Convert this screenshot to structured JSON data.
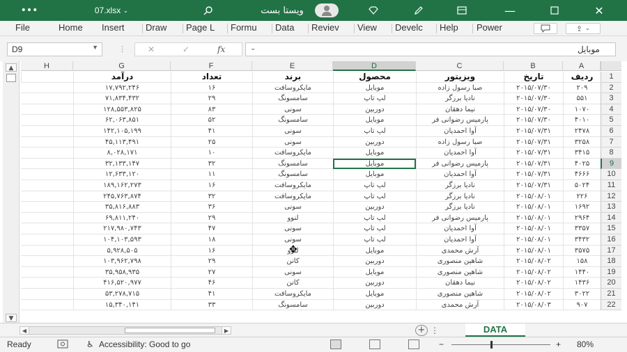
{
  "titlebar": {
    "filename": "07.xlsx",
    "username": "ویستا بست",
    "icons": [
      "more-icon",
      "search-icon",
      "diamond-icon",
      "pen-icon",
      "ribbon-display-icon",
      "minimize-icon",
      "restore-icon",
      "close-icon"
    ]
  },
  "ribbon": {
    "tabs": [
      "File",
      "Home",
      "Insert",
      "Draw",
      "Page L",
      "Formu",
      "Data",
      "Reviev",
      "View",
      "Develc",
      "Help",
      "Power"
    ]
  },
  "formula_bar": {
    "cell_ref": "D9",
    "cancel_symbol": "✕",
    "enter_symbol": "✓",
    "fx_symbol": "fx",
    "content": "موبایل"
  },
  "columns": [
    "H",
    "G",
    "F",
    "E",
    "D",
    "C",
    "B",
    "A"
  ],
  "selected_column": "D",
  "selected_row": "9",
  "table": {
    "header": {
      "A": "ردیف",
      "B": "تاریخ",
      "C": "ویزیتور",
      "D": "محصول",
      "E": "برند",
      "F": "تعداد",
      "G": "درآمد",
      "H": ""
    },
    "rows": [
      {
        "n": "2",
        "A": "۲۰۹",
        "B": "۲۰۱۵/۰۷/۳۰",
        "C": "صبا رسول زاده",
        "D": "موبایل",
        "E": "مایکروسافت",
        "F": "۱۶",
        "G": "۱۷,۷۹۲,۲۴۶"
      },
      {
        "n": "3",
        "A": "۵۵۱",
        "B": "۲۰۱۵/۰۷/۳۰",
        "C": "نادیا برزگر",
        "D": "لپ تاپ",
        "E": "سامسونگ",
        "F": "۲۹",
        "G": "۷۱,۸۳۴,۴۳۲"
      },
      {
        "n": "4",
        "A": "۱۰۷۰",
        "B": "۲۰۱۵/۰۷/۳۰",
        "C": "نیما دهقان",
        "D": "دوربین",
        "E": "سونی",
        "F": "۸۳",
        "G": "۱۲۸,۵۵۳,۸۲۵"
      },
      {
        "n": "5",
        "A": "۴۰۱۰",
        "B": "۲۰۱۵/۰۷/۳۰",
        "C": "پارمیس رضوانی فر",
        "D": "موبایل",
        "E": "سامسونگ",
        "F": "۵۲",
        "G": "۶۲,۰۶۳,۸۵۱"
      },
      {
        "n": "6",
        "A": "۲۴۷۸",
        "B": "۲۰۱۵/۰۷/۳۱",
        "C": "آوا احمدیان",
        "D": "لپ تاپ",
        "E": "سونی",
        "F": "۴۱",
        "G": "۱۴۲,۱۰۵,۱۹۹"
      },
      {
        "n": "7",
        "A": "۳۲۵۸",
        "B": "۲۰۱۵/۰۷/۳۱",
        "C": "صبا رسول زاده",
        "D": "دوربین",
        "E": "سونی",
        "F": "۲۵",
        "G": "۴۵,۱۱۳,۴۹۱"
      },
      {
        "n": "8",
        "A": "۳۴۱۵",
        "B": "۲۰۱۵/۰۷/۳۱",
        "C": "آوا احمدیان",
        "D": "موبایل",
        "E": "مایکروسافت",
        "F": "۱۰",
        "G": "۸,۰۲۸,۱۷۱"
      },
      {
        "n": "9",
        "A": "۴۰۲۵",
        "B": "۲۰۱۵/۰۷/۳۱",
        "C": "پارمیس رضوانی فر",
        "D": "موبایل",
        "E": "سامسونگ",
        "F": "۳۲",
        "G": "۳۲,۱۳۳,۱۴۷"
      },
      {
        "n": "10",
        "A": "۴۶۶۶",
        "B": "۲۰۱۵/۰۷/۳۱",
        "C": "آوا احمدیان",
        "D": "موبایل",
        "E": "سامسونگ",
        "F": "۱۱",
        "G": "۱۲,۶۳۳,۱۲۰"
      },
      {
        "n": "11",
        "A": "۵۰۲۴",
        "B": "۲۰۱۵/۰۷/۳۱",
        "C": "نادیا برزگر",
        "D": "لپ تاپ",
        "E": "مایکروسافت",
        "F": "۱۶",
        "G": "۱۸۹,۱۶۲,۲۷۳"
      },
      {
        "n": "12",
        "A": "۲۲۶",
        "B": "۲۰۱۵/۰۸/۰۱",
        "C": "نادیا برزگر",
        "D": "لپ تاپ",
        "E": "مایکروسافت",
        "F": "۳۲",
        "G": "۲۴۵,۷۶۳,۸۷۴"
      },
      {
        "n": "13",
        "A": "۱۶۹۲",
        "B": "۲۰۱۵/۰۸/۰۱",
        "C": "نادیا برزگر",
        "D": "دوربین",
        "E": "سونی",
        "F": "۳۶",
        "G": "۳۵,۸۱۶,۸۸۳"
      },
      {
        "n": "14",
        "A": "۲۹۶۴",
        "B": "۲۰۱۵/۰۸/۰۱",
        "C": "پارمیس رضوانی فر",
        "D": "لپ تاپ",
        "E": "لنوو",
        "F": "۲۹",
        "G": "۶۹,۸۱۱,۲۴۰"
      },
      {
        "n": "15",
        "A": "۳۳۵۷",
        "B": "۲۰۱۵/۰۸/۰۱",
        "C": "آوا احمدیان",
        "D": "لپ تاپ",
        "E": "سونی",
        "F": "۴۷",
        "G": "۲۱۷,۹۸۰,۷۴۳"
      },
      {
        "n": "16",
        "A": "۳۴۳۲",
        "B": "۲۰۱۵/۰۸/۰۱",
        "C": "آوا احمدیان",
        "D": "لپ تاپ",
        "E": "سونی",
        "F": "۱۸",
        "G": "۱۰۴,۱۰۳,۵۹۳"
      },
      {
        "n": "17",
        "A": "۳۵۷۵",
        "B": "۲۰۱۵/۰۸/۰۱",
        "C": "آرش محمدی",
        "D": "موبایل",
        "E": "لنوو",
        "F": "۱۶",
        "G": "۵,۹۲۸,۵۰۵"
      },
      {
        "n": "18",
        "A": "۱۵۸",
        "B": "۲۰۱۵/۰۸/۰۲",
        "C": "شاهین منصوری",
        "D": "دوربین",
        "E": "کانن",
        "F": "۲۹",
        "G": "۱۰۳,۹۶۲,۷۹۸"
      },
      {
        "n": "19",
        "A": "۱۴۴۰",
        "B": "۲۰۱۵/۰۸/۰۲",
        "C": "شاهین منصوری",
        "D": "موبایل",
        "E": "سونی",
        "F": "۲۷",
        "G": "۳۵,۹۵۸,۹۳۵"
      },
      {
        "n": "20",
        "A": "۱۴۳۶",
        "B": "۲۰۱۵/۰۸/۰۲",
        "C": "نیما دهقان",
        "D": "دوربین",
        "E": "کانن",
        "F": "۴۶",
        "G": "۴۱۶,۵۲۰,۹۷۷"
      },
      {
        "n": "21",
        "A": "۳۰۲۲",
        "B": "۲۰۱۵/۰۸/۰۲",
        "C": "شاهین منصوری",
        "D": "موبایل",
        "E": "مایکروسافت",
        "F": "۴۱",
        "G": "۵۳,۲۷۸,۷۱۵"
      },
      {
        "n": "22",
        "A": "۹۰۷",
        "B": "۲۰۱۵/۰۸/۰۳",
        "C": "آرش محمدی",
        "D": "دوربین",
        "E": "سامسونگ",
        "F": "۳۳",
        "G": "۱۵,۳۴۰,۱۴۱"
      }
    ]
  },
  "sheet_tabs": {
    "active": "DATA",
    "add_symbol": "+",
    "more_symbol": "⋮"
  },
  "statusbar": {
    "ready": "Ready",
    "accessibility": "Accessibility: Good to go",
    "zoom_minus": "−",
    "zoom_plus": "+",
    "zoom": "80%"
  }
}
